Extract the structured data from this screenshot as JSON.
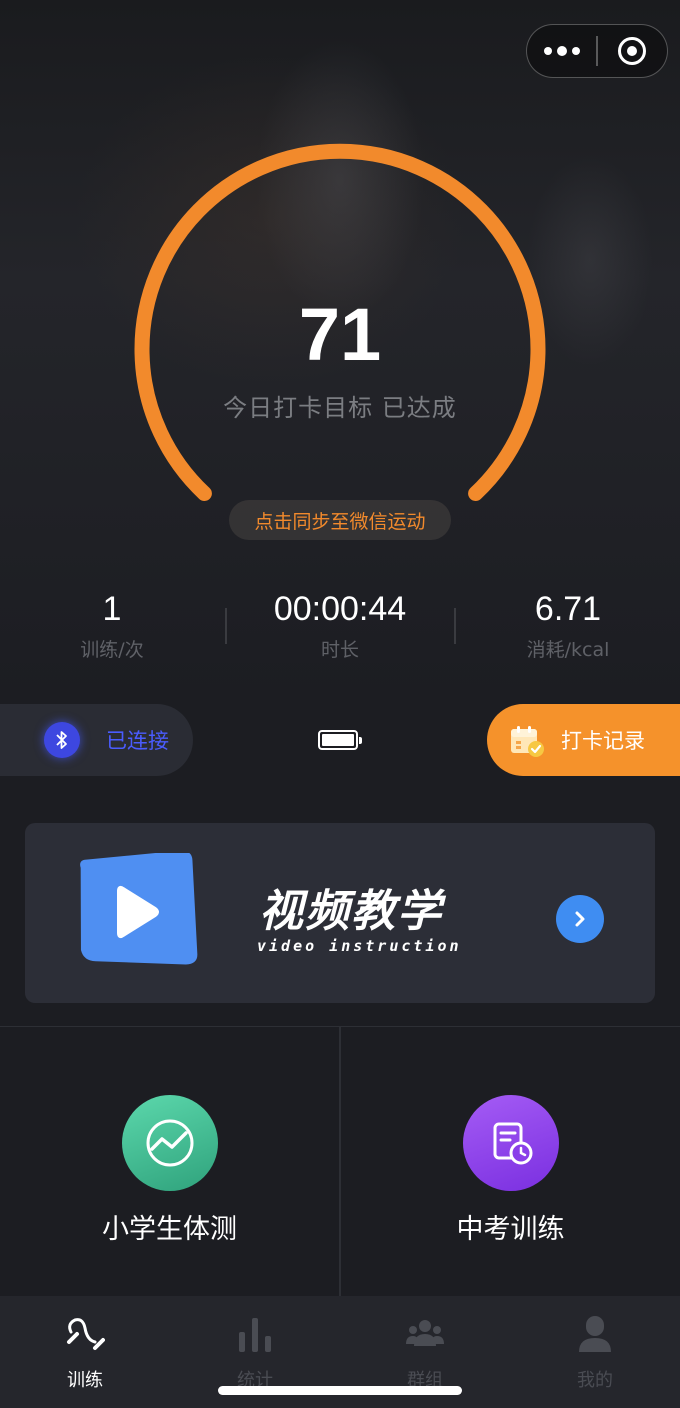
{
  "capsule": {
    "more_icon": "more-dots-icon",
    "close_icon": "target-close-icon"
  },
  "gauge": {
    "count": "71",
    "goal_text": "今日打卡目标 已达成",
    "sync_text": "点击同步至微信运动",
    "arc_color": "#f28a2c"
  },
  "stats": [
    {
      "value": "1",
      "label": "训练/次"
    },
    {
      "value": "00:00:44",
      "label": "时长"
    },
    {
      "value": "6.71",
      "label": "消耗/kcal"
    }
  ],
  "device": {
    "bluetooth_label": "已连接",
    "bluetooth_icon": "bluetooth-icon",
    "battery_icon": "battery-full-icon",
    "battery_level": 1.0,
    "checkin_label": "打卡记录",
    "checkin_icon": "calendar-check-icon"
  },
  "video": {
    "title": "视频教学",
    "subtitle": "video instruction",
    "play_icon": "play-icon",
    "arrow_icon": "chevron-right-icon"
  },
  "tiles": [
    {
      "label": "小学生体测",
      "icon": "trend-chart-icon",
      "color": "#43c59a"
    },
    {
      "label": "中考训练",
      "icon": "document-clock-icon",
      "color": "#8b3ee8"
    }
  ],
  "tabs": [
    {
      "label": "训练",
      "icon": "jump-rope-icon",
      "active": true
    },
    {
      "label": "统计",
      "icon": "bar-chart-icon",
      "active": false
    },
    {
      "label": "群组",
      "icon": "group-icon",
      "active": false
    },
    {
      "label": "我的",
      "icon": "user-icon",
      "active": false
    }
  ]
}
